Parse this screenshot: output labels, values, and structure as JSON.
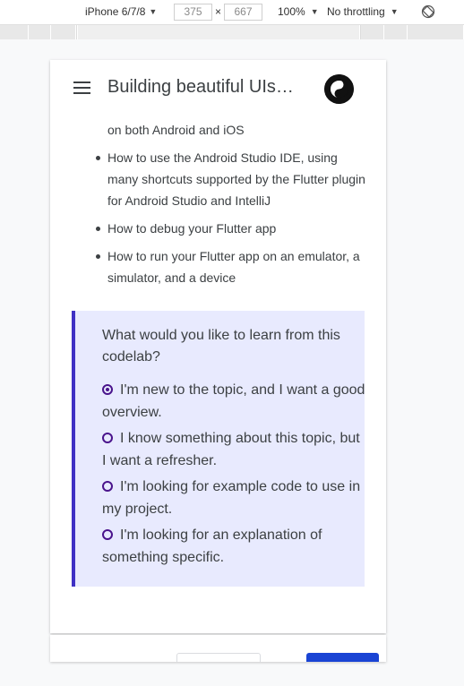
{
  "devtools": {
    "device": "iPhone 6/7/8",
    "width": "375",
    "height": "667",
    "times": "×",
    "zoom": "100%",
    "throttling": "No throttling"
  },
  "appbar": {
    "title": "Building beautiful UIs with Flutter",
    "menu_icon": "hamburger-menu-icon",
    "avatar_icon": "yin-yang-icon"
  },
  "content": {
    "bullet_continuation": "on both Android and iOS",
    "bullets": [
      "How to use the Android Studio IDE, using many shortcuts supported by the Flutter plugin for Android Studio and IntelliJ",
      "How to debug your Flutter app",
      "How to run your Flutter app on an emulator, a simulator, and a device"
    ]
  },
  "survey": {
    "question": "What would you like to learn from this codelab?",
    "selected_index": 0,
    "options": [
      "I'm new to the topic, and I want a good overview.",
      "I know something about this topic, but I want a refresher.",
      "I'm looking for example code to use in my project.",
      "I'm looking for an explanation of something specific."
    ]
  },
  "colors": {
    "accent": "#4a148c",
    "survey_bg": "#e8eafe",
    "survey_border": "#3f30c4",
    "primary_button": "#1a44d4"
  }
}
